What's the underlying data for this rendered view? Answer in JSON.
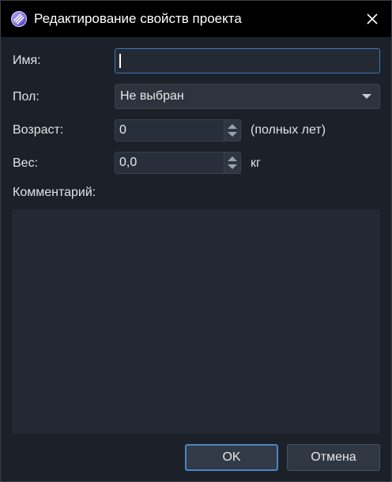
{
  "window": {
    "title": "Редактирование свойств проекта",
    "icon": "project-icon",
    "close_icon": "close-icon"
  },
  "form": {
    "name": {
      "label": "Имя:",
      "value": ""
    },
    "gender": {
      "label": "Пол:",
      "value": "Не выбран"
    },
    "age": {
      "label": "Возраст:",
      "value": "0",
      "unit": "(полных лет)"
    },
    "weight": {
      "label": "Вес:",
      "value": "0,0",
      "unit": "кг"
    },
    "comment": {
      "label": "Комментарий:",
      "value": ""
    }
  },
  "buttons": {
    "ok": "OK",
    "cancel": "Отмена"
  },
  "colors": {
    "background": "#1c2129",
    "titlebar": "#000000",
    "accent": "#4a86c5"
  }
}
